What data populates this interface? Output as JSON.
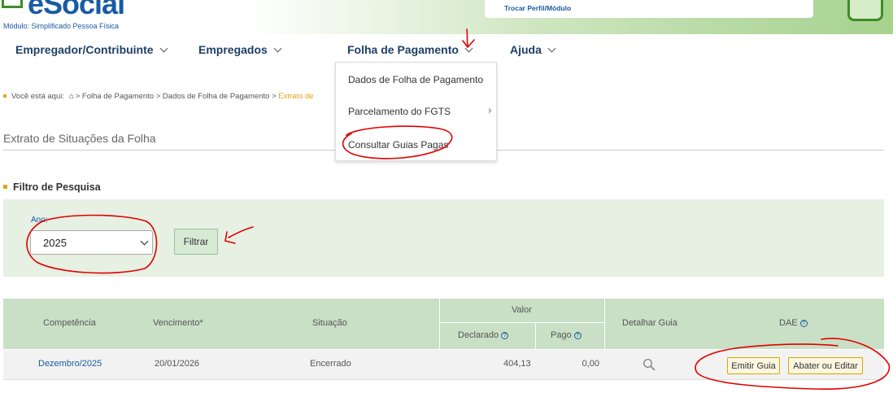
{
  "header": {
    "logo_text": "eSocial",
    "module_label": "Módulo: Simplificado Pessoa Física",
    "profile_link": "Trocar Perfil/Módulo"
  },
  "nav": {
    "items": [
      {
        "label": "Empregador/Contribuinte"
      },
      {
        "label": "Empregados"
      },
      {
        "label": "Folha de Pagamento"
      },
      {
        "label": "Ajuda"
      }
    ]
  },
  "dropdown": {
    "items": [
      {
        "label": "Dados de Folha de Pagamento"
      },
      {
        "label": "Parcelamento do FGTS"
      },
      {
        "label": "Consultar Guias Pagas"
      }
    ]
  },
  "breadcrumb": {
    "prefix": "Você está aqui:",
    "path": "> Folha de Pagamento > Dados de Folha de Pagamento >",
    "current": "Extrato de"
  },
  "page": {
    "title": "Extrato de Situações da Folha"
  },
  "filter": {
    "section_title": "Filtro de Pesquisa",
    "ano_label": "Ano:",
    "ano_value": "2025",
    "button_label": "Filtrar"
  },
  "table": {
    "headers": {
      "competencia": "Competência",
      "vencimento": "Vencimento*",
      "situacao": "Situação",
      "valor": "Valor",
      "declarado": "Declarado",
      "pago": "Pago",
      "detalhar": "Detalhar Guia",
      "dae": "DAE"
    },
    "rows": [
      {
        "competencia": "Dezembro/2025",
        "vencimento": "20/01/2026",
        "situacao": "Encerrado",
        "declarado": "404,13",
        "pago": "0,00",
        "emitir_label": "Emitir Guia",
        "abater_label": "Abater ou Editar"
      }
    ]
  },
  "colors": {
    "nav_text": "#1e3f66",
    "link": "#1a5aa3",
    "accent": "#e8a317",
    "panel": "#e6f0e3",
    "table_header": "#c9e0c6",
    "annotation": "#e00000"
  }
}
